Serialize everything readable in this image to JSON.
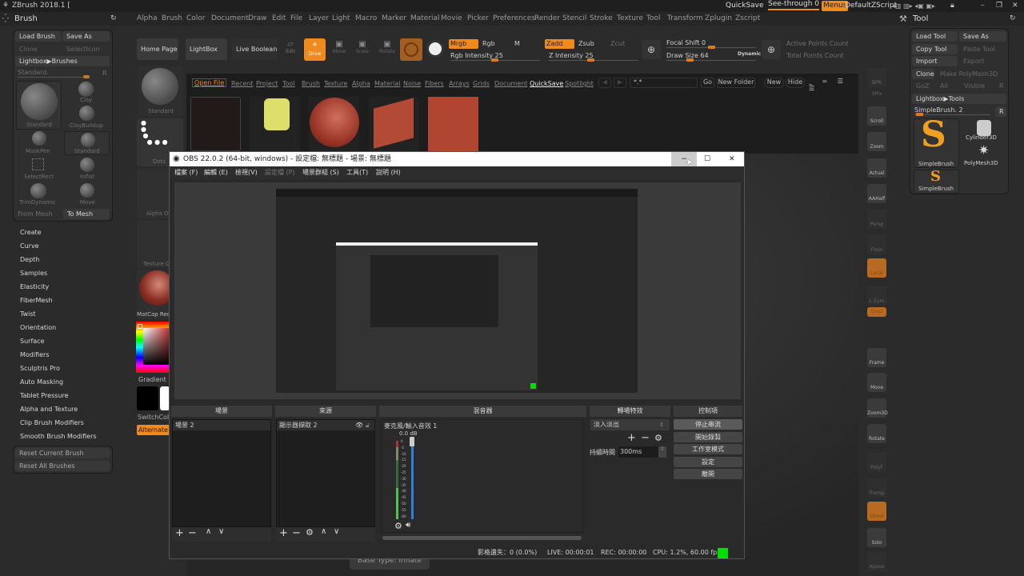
{
  "zbrush": {
    "title": "ZBrush 2018.1 [",
    "top_right": {
      "quicksave": "QuickSave",
      "see_through": "See-through  0",
      "menus": "Menus",
      "script": "DefaultZScript"
    },
    "menu": [
      "Alpha",
      "Brush",
      "Color",
      "Document",
      "Draw",
      "Edit",
      "File",
      "Layer",
      "Light",
      "Macro",
      "Marker",
      "Material",
      "Movie",
      "Picker",
      "Preferences",
      "Render",
      "Stencil",
      "Stroke",
      "Texture",
      "Tool",
      "Transform",
      "Zplugin",
      "Zscript"
    ],
    "brush_palette": {
      "title": "Brush",
      "load": "Load Brush",
      "save_as": "Save As",
      "clone": "Clone",
      "select_icon": "SelectIcon",
      "lightbox": "Lightbox▶Brushes",
      "current": "Standard.",
      "r": "R",
      "brushes": [
        "Standard",
        "Clay",
        "ClayBuildup",
        "MaskPen",
        "Standard",
        "SelectRect",
        "Inflat",
        "TrimDynamic",
        "Move"
      ],
      "from_mesh": "From Mesh",
      "to_mesh": "To Mesh",
      "sections": [
        "Create",
        "Curve",
        "Depth",
        "Samples",
        "Elasticity",
        "FiberMesh",
        "Twist",
        "Orientation",
        "Surface",
        "Modifiers",
        "Sculptris Pro",
        "Auto Masking",
        "Tablet Pressure",
        "Alpha and Texture",
        "Clip Brush Modifiers",
        "Smooth Brush Modifiers"
      ],
      "reset_current": "Reset Current Brush",
      "reset_all": "Reset All Brushes"
    },
    "shelf": {
      "home": "Home Page",
      "lightbox": "LightBox",
      "live_boolean": "Live Boolean",
      "edit": "Edit",
      "draw": "Draw",
      "move": "Move",
      "scale": "Scale",
      "rotate": "Rotate",
      "mrgb": "Mrgb",
      "rgb": "Rgb",
      "m": "M",
      "rgb_intensity": "Rgb Intensity 25",
      "zadd": "Zadd",
      "zsub": "Zsub",
      "zcut": "Zcut",
      "z_intensity": "Z Intensity 25",
      "focal_shift": "Focal Shift 0",
      "draw_size": "Draw Size 64",
      "dynamic": "Dynamic",
      "active_points": "Active Points Count",
      "total_points": "Total Points Count"
    },
    "lightbox_tabs": [
      "Open File",
      "Recent",
      "Project",
      "Tool",
      "Brush",
      "Texture",
      "Alpha",
      "Material",
      "Noise",
      "Fibers",
      "Arrays",
      "Grids",
      "Document",
      "QuickSave",
      "Spotlight"
    ],
    "lightbox_controls": {
      "path": "*.*",
      "go": "Go",
      "new_folder": "New Folder",
      "new": "New",
      "hide": "Hide"
    },
    "left_shelf": {
      "standard": "Standard",
      "dots": "Dots",
      "alpha": "Alpha Off",
      "texture": "Texture Off",
      "matcap": "MatCap Red",
      "gradient": "Gradient",
      "switch": "SwitchColor",
      "alternate": "Alternate"
    },
    "right_shelf": [
      "BPR",
      "SPix",
      "Scroll",
      "Zoom",
      "Actual",
      "AAHalf",
      "Persp",
      "Floor",
      "Local",
      "L.Sym",
      "Gxyz",
      "Frame",
      "Move",
      "Zoom3D",
      "Rotate",
      "PolyF",
      "Transp",
      "Ghost",
      "Solo",
      "Xpose"
    ],
    "tool_palette": {
      "title": "Tool",
      "load": "Load Tool",
      "save_as": "Save As",
      "copy": "Copy Tool",
      "paste": "Paste Tool",
      "import": "Import",
      "export": "Export",
      "clone": "Clone",
      "make_poly": "Make PolyMesh3D",
      "goz": "GoZ",
      "all": "All",
      "visible": "Visible",
      "r": "R",
      "lightbox": "Lightbox▶Tools",
      "current": "SimpleBrush. 2",
      "tools": [
        "SimpleBrush",
        "Cylinder3D",
        "PolyMesh3D",
        "SimpleBrush"
      ]
    },
    "bottom_hint": "Base Type: Inflate"
  },
  "obs": {
    "title": "OBS 22.0.2 (64-bit, windows) - 設定檔: 無標題 - 場景: 無標題",
    "menu": [
      "檔案 (F)",
      "編輯 (E)",
      "檢視(V)",
      "設定檔 (P)",
      "場景群組 (S)",
      "工具(T)",
      "說明 (H)"
    ],
    "docks": {
      "scenes": "場景",
      "sources": "來源",
      "mixer": "混音器",
      "transitions": "轉場特效",
      "controls": "控制項"
    },
    "scene_items": [
      "場景 2"
    ],
    "source_items": [
      "顯示器擷取 2"
    ],
    "mixer": {
      "channel": "麥克風/輸入音效 1",
      "db": "0.0 dB",
      "ticks": [
        "0",
        "-5",
        "-10",
        "-15",
        "-20",
        "-25",
        "-30",
        "-35",
        "-40",
        "-45",
        "-50",
        "-55",
        "-60"
      ]
    },
    "transition": {
      "selected": "淡入淡出",
      "duration_label": "持續時間",
      "duration": "300ms"
    },
    "controls": [
      "停止串流",
      "開始錄製",
      "工作室模式",
      "設定",
      "離開"
    ],
    "status": {
      "dropped": "影格遺失：0 (0.0%)",
      "live": "LIVE: 00:00:01",
      "rec": "REC: 00:00:00",
      "cpu": "CPU: 1.2%, 60.00 fps"
    },
    "colors": {
      "status_ok": "#00e000",
      "meter_blue": "#2f7fd8",
      "meter_green": "#4fc24f"
    }
  },
  "colors": {
    "accent": "#f08a1c",
    "bg": "#2b2b2b"
  }
}
